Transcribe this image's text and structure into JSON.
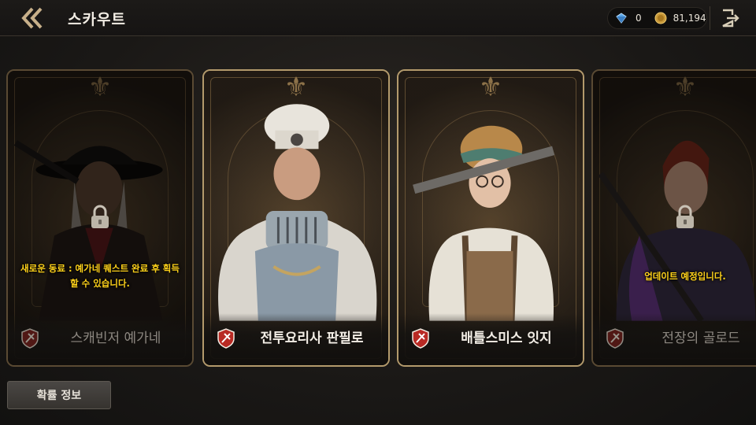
{
  "header": {
    "title": "스카우트",
    "gems": "0",
    "gold": "81,194",
    "back_icon": "double-chevron-left-icon",
    "exit_icon": "exit-door-icon",
    "gem_icon": "blue-gem-icon",
    "gold_icon": "gold-coin-icon"
  },
  "cards": [
    {
      "name": "스캐빈저 예가네",
      "state": "locked",
      "notice_line1": "새로운 동료 : 예가네 퀘스트 완료 후 획득",
      "notice_line2": "할 수 있습니다."
    },
    {
      "name": "전투요리사 판필로",
      "state": "available"
    },
    {
      "name": "배틀스미스 잇지",
      "state": "available"
    },
    {
      "name": "전장의 골로드",
      "state": "locked",
      "notice_line1": "업데이트 예정입니다."
    }
  ],
  "footer": {
    "probability_label": "확률 정보"
  },
  "colors": {
    "accent_gold": "#b39a6c",
    "notice_yellow": "#ffd21a",
    "badge_red": "#c8342c"
  }
}
